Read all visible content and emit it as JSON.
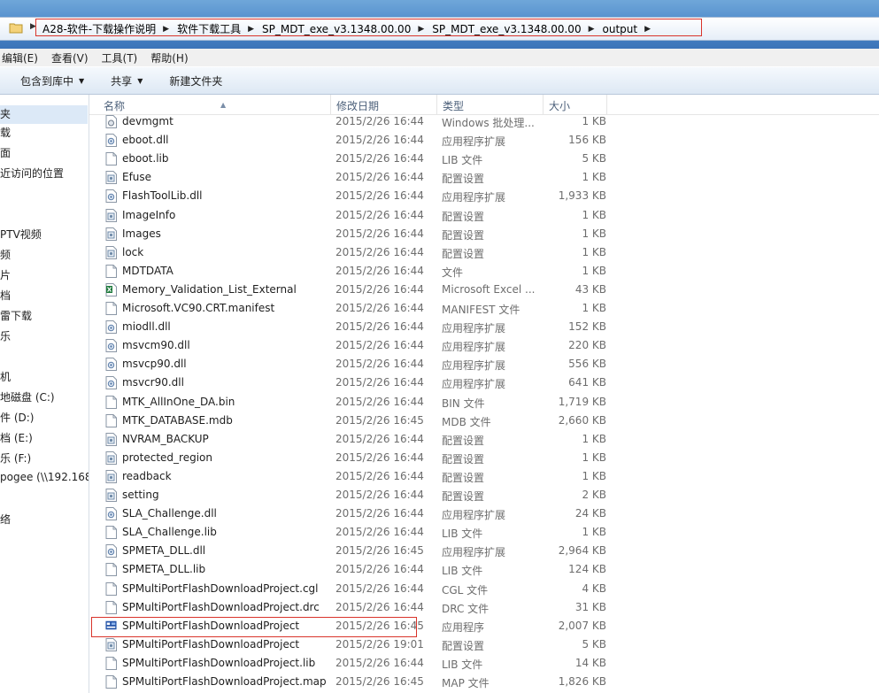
{
  "breadcrumb": [
    "A28-软件-下载操作说明",
    "软件下载工具",
    "SP_MDT_exe_v3.1348.00.00",
    "SP_MDT_exe_v3.1348.00.00",
    "output"
  ],
  "menu": [
    "编辑(E)",
    "查看(V)",
    "工具(T)",
    "帮助(H)"
  ],
  "toolbar": {
    "include": "包含到库中",
    "share": "共享",
    "new_folder": "新建文件夹"
  },
  "nav": [
    "夹",
    "载",
    "面",
    "近访问的位置",
    "PTV视频",
    "频",
    "片",
    "档",
    "雷下载",
    "乐",
    "机",
    "地磁盘 (C:)",
    "件 (D:)",
    "档 (E:)",
    "乐 (F:)",
    "pogee (\\\\192.168",
    "络"
  ],
  "columns": {
    "name": "名称",
    "date": "修改日期",
    "type": "类型",
    "size": "大小"
  },
  "files": [
    {
      "name": "devmgmt",
      "date": "2015/2/26 16:44",
      "type": "Windows 批处理...",
      "size": "1 KB",
      "icon": "batch-file-icon"
    },
    {
      "name": "eboot.dll",
      "date": "2015/2/26 16:44",
      "type": "应用程序扩展",
      "size": "156 KB",
      "icon": "dll-file-icon"
    },
    {
      "name": "eboot.lib",
      "date": "2015/2/26 16:44",
      "type": "LIB 文件",
      "size": "5 KB",
      "icon": "blank-file-icon"
    },
    {
      "name": "Efuse",
      "date": "2015/2/26 16:44",
      "type": "配置设置",
      "size": "1 KB",
      "icon": "config-file-icon"
    },
    {
      "name": "FlashToolLib.dll",
      "date": "2015/2/26 16:44",
      "type": "应用程序扩展",
      "size": "1,933 KB",
      "icon": "dll-file-icon"
    },
    {
      "name": "ImageInfo",
      "date": "2015/2/26 16:44",
      "type": "配置设置",
      "size": "1 KB",
      "icon": "config-file-icon"
    },
    {
      "name": "Images",
      "date": "2015/2/26 16:44",
      "type": "配置设置",
      "size": "1 KB",
      "icon": "config-file-icon"
    },
    {
      "name": "lock",
      "date": "2015/2/26 16:44",
      "type": "配置设置",
      "size": "1 KB",
      "icon": "config-file-icon"
    },
    {
      "name": "MDTDATA",
      "date": "2015/2/26 16:44",
      "type": "文件",
      "size": "1 KB",
      "icon": "blank-file-icon"
    },
    {
      "name": "Memory_Validation_List_External",
      "date": "2015/2/26 16:44",
      "type": "Microsoft Excel ...",
      "size": "43 KB",
      "icon": "excel-file-icon"
    },
    {
      "name": "Microsoft.VC90.CRT.manifest",
      "date": "2015/2/26 16:44",
      "type": "MANIFEST 文件",
      "size": "1 KB",
      "icon": "blank-file-icon"
    },
    {
      "name": "miodll.dll",
      "date": "2015/2/26 16:44",
      "type": "应用程序扩展",
      "size": "152 KB",
      "icon": "dll-file-icon"
    },
    {
      "name": "msvcm90.dll",
      "date": "2015/2/26 16:44",
      "type": "应用程序扩展",
      "size": "220 KB",
      "icon": "dll-file-icon"
    },
    {
      "name": "msvcp90.dll",
      "date": "2015/2/26 16:44",
      "type": "应用程序扩展",
      "size": "556 KB",
      "icon": "dll-file-icon"
    },
    {
      "name": "msvcr90.dll",
      "date": "2015/2/26 16:44",
      "type": "应用程序扩展",
      "size": "641 KB",
      "icon": "dll-file-icon"
    },
    {
      "name": "MTK_AllInOne_DA.bin",
      "date": "2015/2/26 16:44",
      "type": "BIN 文件",
      "size": "1,719 KB",
      "icon": "blank-file-icon"
    },
    {
      "name": "MTK_DATABASE.mdb",
      "date": "2015/2/26 16:45",
      "type": "MDB 文件",
      "size": "2,660 KB",
      "icon": "blank-file-icon"
    },
    {
      "name": "NVRAM_BACKUP",
      "date": "2015/2/26 16:44",
      "type": "配置设置",
      "size": "1 KB",
      "icon": "config-file-icon"
    },
    {
      "name": "protected_region",
      "date": "2015/2/26 16:44",
      "type": "配置设置",
      "size": "1 KB",
      "icon": "config-file-icon"
    },
    {
      "name": "readback",
      "date": "2015/2/26 16:44",
      "type": "配置设置",
      "size": "1 KB",
      "icon": "config-file-icon"
    },
    {
      "name": "setting",
      "date": "2015/2/26 16:44",
      "type": "配置设置",
      "size": "2 KB",
      "icon": "config-file-icon"
    },
    {
      "name": "SLA_Challenge.dll",
      "date": "2015/2/26 16:44",
      "type": "应用程序扩展",
      "size": "24 KB",
      "icon": "dll-file-icon"
    },
    {
      "name": "SLA_Challenge.lib",
      "date": "2015/2/26 16:44",
      "type": "LIB 文件",
      "size": "1 KB",
      "icon": "blank-file-icon"
    },
    {
      "name": "SPMETA_DLL.dll",
      "date": "2015/2/26 16:45",
      "type": "应用程序扩展",
      "size": "2,964 KB",
      "icon": "dll-file-icon"
    },
    {
      "name": "SPMETA_DLL.lib",
      "date": "2015/2/26 16:44",
      "type": "LIB 文件",
      "size": "124 KB",
      "icon": "blank-file-icon"
    },
    {
      "name": "SPMultiPortFlashDownloadProject.cgl",
      "date": "2015/2/26 16:44",
      "type": "CGL 文件",
      "size": "4 KB",
      "icon": "blank-file-icon"
    },
    {
      "name": "SPMultiPortFlashDownloadProject.drc",
      "date": "2015/2/26 16:44",
      "type": "DRC 文件",
      "size": "31 KB",
      "icon": "blank-file-icon"
    },
    {
      "name": "SPMultiPortFlashDownloadProject",
      "date": "2015/2/26 16:45",
      "type": "应用程序",
      "size": "2,007 KB",
      "icon": "app-exe-icon"
    },
    {
      "name": "SPMultiPortFlashDownloadProject",
      "date": "2015/2/26 19:01",
      "type": "配置设置",
      "size": "5 KB",
      "icon": "config-file-icon"
    },
    {
      "name": "SPMultiPortFlashDownloadProject.lib",
      "date": "2015/2/26 16:44",
      "type": "LIB 文件",
      "size": "14 KB",
      "icon": "blank-file-icon"
    },
    {
      "name": "SPMultiPortFlashDownloadProject.map",
      "date": "2015/2/26 16:45",
      "type": "MAP 文件",
      "size": "1,826 KB",
      "icon": "blank-file-icon"
    }
  ]
}
